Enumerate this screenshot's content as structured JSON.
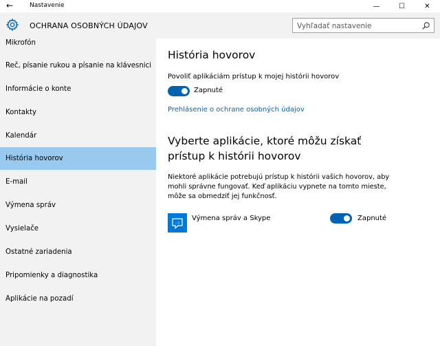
{
  "window": {
    "title": "Nastavenie",
    "back_glyph": "←",
    "minimize_glyph": "—",
    "maximize_glyph": "☐",
    "close_glyph": "✕"
  },
  "header": {
    "title": "OCHRANA OSOBNÝCH ÚDAJOV",
    "search_placeholder": "Vyhľadať nastavenie",
    "icon": "gear-icon",
    "search_icon": "search-icon"
  },
  "sidebar": {
    "active_index": 5,
    "items": [
      {
        "label": "Mikrofón"
      },
      {
        "label": "Reč, písanie rukou a písanie na klávesnici"
      },
      {
        "label": "Informácie o konte"
      },
      {
        "label": "Kontakty"
      },
      {
        "label": "Kalendár"
      },
      {
        "label": "História hovorov"
      },
      {
        "label": "E-mail"
      },
      {
        "label": "Výmena správ"
      },
      {
        "label": "Vysielače"
      },
      {
        "label": "Ostatné zariadenia"
      },
      {
        "label": "Pripomienky a diagnostika"
      },
      {
        "label": "Aplikácie na pozadí"
      }
    ]
  },
  "main": {
    "title": "História hovorov",
    "allow_label": "Povoliť aplikáciám prístup k mojej histórii hovorov",
    "allow_toggle": {
      "state": "Zapnuté",
      "on": true
    },
    "privacy_link": "Prehlásenie o ochrane osobných údajov",
    "choose_title": "Vyberte aplikácie, ktoré môžu získať prístup k histórii hovorov",
    "description": "Niektoré aplikácie potrebujú prístup k histórii vašich hovorov, aby mohli správne fungovať. Keď aplikáciu vypnete na tomto mieste, môže sa obmedziť jej funkčnosť.",
    "apps": [
      {
        "name": "Výmena správ a Skype",
        "icon": "messaging-skype-icon",
        "toggle_state": "Zapnuté",
        "on": true
      }
    ]
  },
  "colors": {
    "accent": "#0063b1",
    "sidebar_bg": "#f2f2f2",
    "active_item_bg": "#99c9ef",
    "app_icon_bg": "#0078d7"
  }
}
